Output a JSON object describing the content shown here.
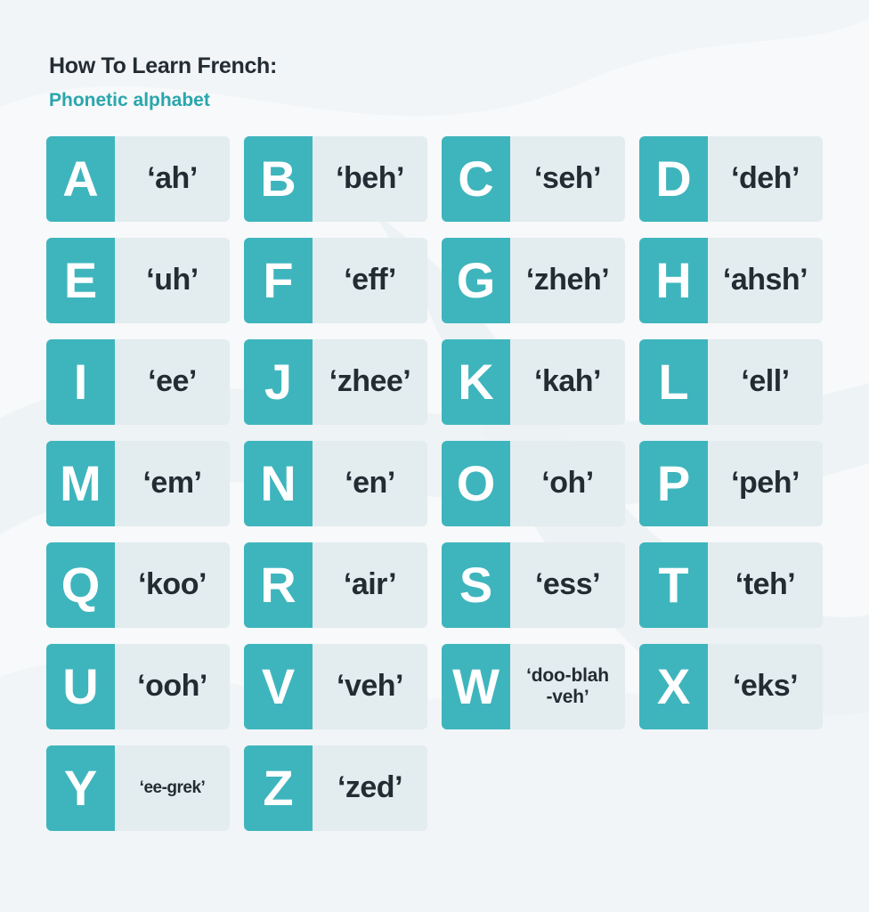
{
  "header": {
    "title": "How To Learn French:",
    "subtitle": "Phonetic alphabet"
  },
  "letters": [
    {
      "letter": "A",
      "sound": "‘ah’"
    },
    {
      "letter": "B",
      "sound": "‘beh’"
    },
    {
      "letter": "C",
      "sound": "‘seh’"
    },
    {
      "letter": "D",
      "sound": "‘deh’"
    },
    {
      "letter": "E",
      "sound": "‘uh’"
    },
    {
      "letter": "F",
      "sound": "‘eff’"
    },
    {
      "letter": "G",
      "sound": "‘zheh’"
    },
    {
      "letter": "H",
      "sound": "‘ahsh’"
    },
    {
      "letter": "I",
      "sound": "‘ee’"
    },
    {
      "letter": "J",
      "sound": "‘zhee’"
    },
    {
      "letter": "K",
      "sound": "‘kah’"
    },
    {
      "letter": "L",
      "sound": "‘ell’"
    },
    {
      "letter": "M",
      "sound": "‘em’"
    },
    {
      "letter": "N",
      "sound": "‘en’"
    },
    {
      "letter": "O",
      "sound": "‘oh’"
    },
    {
      "letter": "P",
      "sound": "‘peh’"
    },
    {
      "letter": "Q",
      "sound": "‘koo’"
    },
    {
      "letter": "R",
      "sound": "‘air’"
    },
    {
      "letter": "S",
      "sound": "‘ess’"
    },
    {
      "letter": "T",
      "sound": "‘teh’"
    },
    {
      "letter": "U",
      "sound": "‘ooh’"
    },
    {
      "letter": "V",
      "sound": "‘veh’"
    },
    {
      "letter": "W",
      "sound": "‘doo-blah\n-veh’"
    },
    {
      "letter": "X",
      "sound": "‘eks’"
    },
    {
      "letter": "Y",
      "sound": "‘ee-grek’"
    },
    {
      "letter": "Z",
      "sound": "‘zed’"
    }
  ],
  "colors": {
    "accent": "#3eb5bd",
    "card_bg": "#e3ecef",
    "text_dark": "#232c33",
    "subtitle": "#2aa6ad"
  }
}
